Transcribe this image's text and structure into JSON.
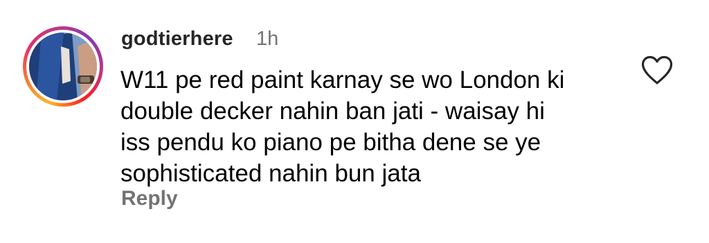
{
  "comment": {
    "username": "godtierhere",
    "timestamp": "1h",
    "text_lines": [
      "W11 pe red paint karnay se wo London ki",
      "double decker nahin ban jati - waisay hi",
      "iss pendu ko piano pe bitha dene se ye",
      "sophisticated nahin bun jata"
    ],
    "reply_label": "Reply",
    "like_icon": "heart-outline-icon",
    "avatar_icon": "profile-photo"
  },
  "colors": {
    "username": "#262626",
    "muted": "#737373",
    "text": "#000000",
    "story_ring_start": "#f9b72b",
    "story_ring_mid": "#e1306c",
    "story_ring_end": "#833ab4"
  }
}
